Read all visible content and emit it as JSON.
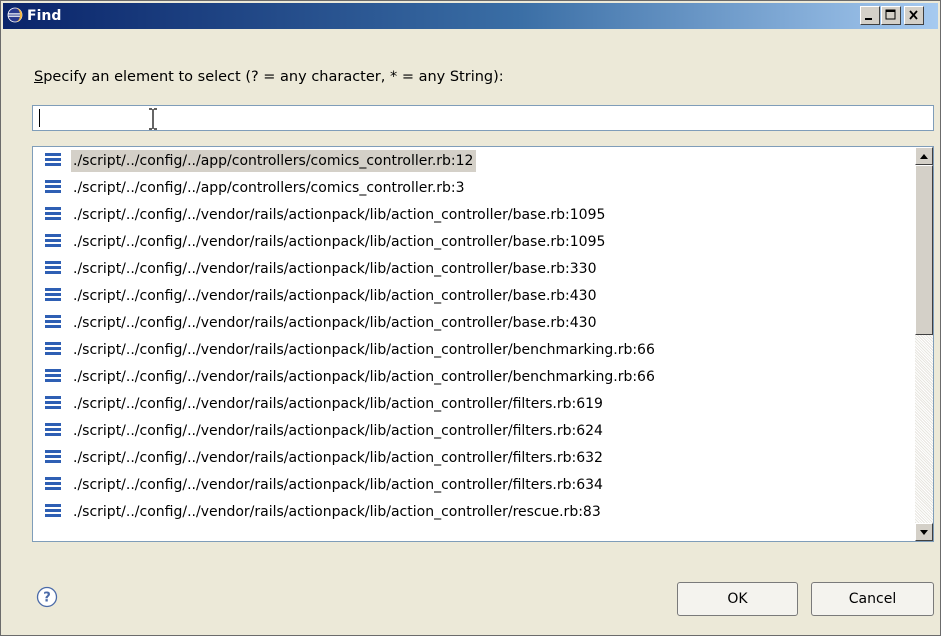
{
  "window": {
    "title": "Find",
    "minimize_icon": "minimize-icon",
    "maximize_icon": "maximize-icon",
    "close_icon": "close-icon"
  },
  "prompt": {
    "mnemonic": "S",
    "rest": "pecify an element to select (? = any character, * = any String):"
  },
  "search": {
    "value": "",
    "placeholder": ""
  },
  "results": {
    "items": [
      "./script/../config/../app/controllers/comics_controller.rb:12",
      "./script/../config/../app/controllers/comics_controller.rb:3",
      "./script/../config/../vendor/rails/actionpack/lib/action_controller/base.rb:1095",
      "./script/../config/../vendor/rails/actionpack/lib/action_controller/base.rb:1095",
      "./script/../config/../vendor/rails/actionpack/lib/action_controller/base.rb:330",
      "./script/../config/../vendor/rails/actionpack/lib/action_controller/base.rb:430",
      "./script/../config/../vendor/rails/actionpack/lib/action_controller/base.rb:430",
      "./script/../config/../vendor/rails/actionpack/lib/action_controller/benchmarking.rb:66",
      "./script/../config/../vendor/rails/actionpack/lib/action_controller/benchmarking.rb:66",
      "./script/../config/../vendor/rails/actionpack/lib/action_controller/filters.rb:619",
      "./script/../config/../vendor/rails/actionpack/lib/action_controller/filters.rb:624",
      "./script/../config/../vendor/rails/actionpack/lib/action_controller/filters.rb:632",
      "./script/../config/../vendor/rails/actionpack/lib/action_controller/filters.rb:634",
      "./script/../config/../vendor/rails/actionpack/lib/action_controller/rescue.rb:83"
    ],
    "selected_index": 0,
    "item_icon": "stack-frame-icon"
  },
  "buttons": {
    "ok": "OK",
    "cancel": "Cancel",
    "help_icon": "help-icon"
  },
  "colors": {
    "selection": "#d4d0c8",
    "titlebar_start": "#0a246a",
    "icon_blue": "#2e5fb4"
  }
}
